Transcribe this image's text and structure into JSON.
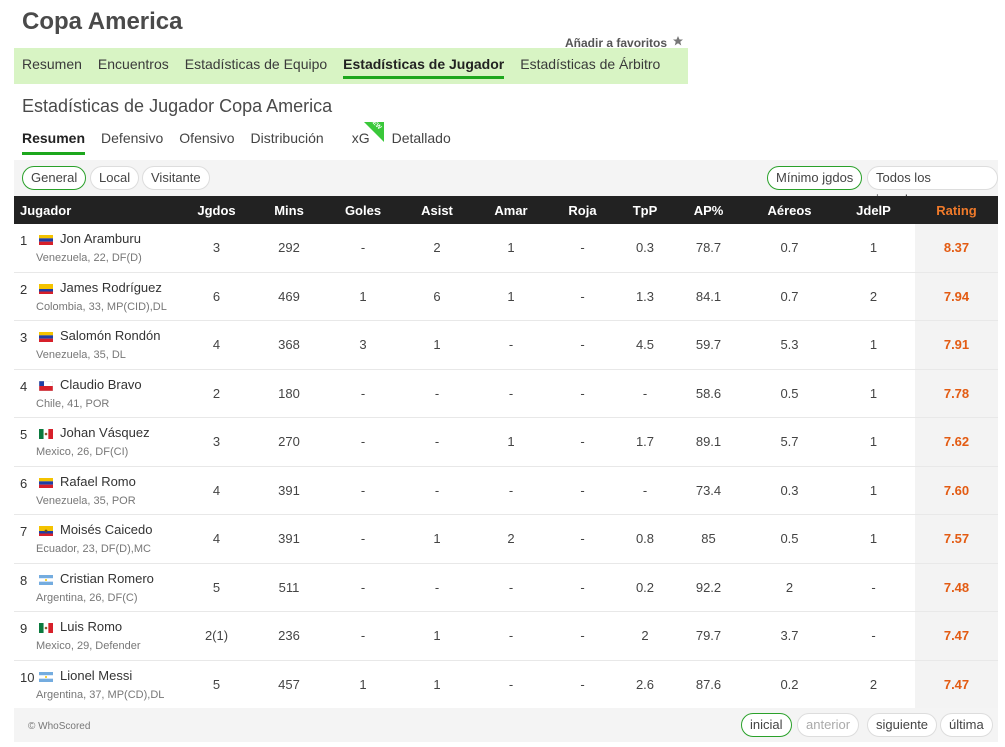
{
  "page": {
    "title": "Copa America",
    "favorite_label": "Añadir a favoritos"
  },
  "topnav": [
    "Resumen",
    "Encuentros",
    "Estadísticas de Equipo",
    "Estadísticas de Jugador",
    "Estadísticas de Árbitro"
  ],
  "subtitle": "Estadísticas de Jugador Copa America",
  "subnav": [
    "Resumen",
    "Defensivo",
    "Ofensivo",
    "Distribución",
    "xG",
    "Detallado"
  ],
  "new_badge": "NEW",
  "filters": {
    "left": [
      "General",
      "Local",
      "Visitante"
    ],
    "right": [
      "Mínimo jgdos",
      "Todos los jugadores"
    ]
  },
  "columns": [
    "Jugador",
    "Jgdos",
    "Mins",
    "Goles",
    "Asist",
    "Amar",
    "Roja",
    "TpP",
    "AP%",
    "Aéreos",
    "JdelP",
    "Rating"
  ],
  "colors": {
    "accent": "#1da71d",
    "rating": "#e35b12",
    "header_bg": "#222222",
    "nav_bg": "#d8f4c4"
  },
  "players": [
    {
      "rank": "1",
      "name": "Jon Aramburu",
      "meta": "Venezuela,  22, DF(D)",
      "flag": "venezuela",
      "jgdos": "3",
      "mins": "292",
      "goles": "-",
      "asist": "2",
      "amar": "1",
      "roja": "-",
      "tpp": "0.3",
      "ap": "78.7",
      "aereos": "0.7",
      "jdelp": "1",
      "rating": "8.37"
    },
    {
      "rank": "2",
      "name": "James Rodríguez",
      "meta": "Colombia,  33, MP(CID),DL",
      "flag": "colombia",
      "jgdos": "6",
      "mins": "469",
      "goles": "1",
      "asist": "6",
      "amar": "1",
      "roja": "-",
      "tpp": "1.3",
      "ap": "84.1",
      "aereos": "0.7",
      "jdelp": "2",
      "rating": "7.94"
    },
    {
      "rank": "3",
      "name": "Salomón Rondón",
      "meta": "Venezuela,  35, DL",
      "flag": "venezuela",
      "jgdos": "4",
      "mins": "368",
      "goles": "3",
      "asist": "1",
      "amar": "-",
      "roja": "-",
      "tpp": "4.5",
      "ap": "59.7",
      "aereos": "5.3",
      "jdelp": "1",
      "rating": "7.91"
    },
    {
      "rank": "4",
      "name": "Claudio Bravo",
      "meta": "Chile,  41, POR",
      "flag": "chile",
      "jgdos": "2",
      "mins": "180",
      "goles": "-",
      "asist": "-",
      "amar": "-",
      "roja": "-",
      "tpp": "-",
      "ap": "58.6",
      "aereos": "0.5",
      "jdelp": "1",
      "rating": "7.78"
    },
    {
      "rank": "5",
      "name": "Johan Vásquez",
      "meta": "Mexico,  26, DF(CI)",
      "flag": "mexico",
      "jgdos": "3",
      "mins": "270",
      "goles": "-",
      "asist": "-",
      "amar": "1",
      "roja": "-",
      "tpp": "1.7",
      "ap": "89.1",
      "aereos": "5.7",
      "jdelp": "1",
      "rating": "7.62"
    },
    {
      "rank": "6",
      "name": "Rafael Romo",
      "meta": "Venezuela,  35, POR",
      "flag": "venezuela",
      "jgdos": "4",
      "mins": "391",
      "goles": "-",
      "asist": "-",
      "amar": "-",
      "roja": "-",
      "tpp": "-",
      "ap": "73.4",
      "aereos": "0.3",
      "jdelp": "1",
      "rating": "7.60"
    },
    {
      "rank": "7",
      "name": "Moisés Caicedo",
      "meta": "Ecuador,  23, DF(D),MC",
      "flag": "ecuador",
      "jgdos": "4",
      "mins": "391",
      "goles": "-",
      "asist": "1",
      "amar": "2",
      "roja": "-",
      "tpp": "0.8",
      "ap": "85",
      "aereos": "0.5",
      "jdelp": "1",
      "rating": "7.57"
    },
    {
      "rank": "8",
      "name": "Cristian Romero",
      "meta": "Argentina,  26, DF(C)",
      "flag": "argentina",
      "jgdos": "5",
      "mins": "511",
      "goles": "-",
      "asist": "-",
      "amar": "-",
      "roja": "-",
      "tpp": "0.2",
      "ap": "92.2",
      "aereos": "2",
      "jdelp": "-",
      "rating": "7.48"
    },
    {
      "rank": "9",
      "name": "Luis Romo",
      "meta": "Mexico,  29, Defender",
      "flag": "mexico",
      "jgdos": "2(1)",
      "mins": "236",
      "goles": "-",
      "asist": "1",
      "amar": "-",
      "roja": "-",
      "tpp": "2",
      "ap": "79.7",
      "aereos": "3.7",
      "jdelp": "-",
      "rating": "7.47"
    },
    {
      "rank": "10",
      "name": "Lionel Messi",
      "meta": "Argentina,  37, MP(CD),DL",
      "flag": "argentina",
      "jgdos": "5",
      "mins": "457",
      "goles": "1",
      "asist": "1",
      "amar": "-",
      "roja": "-",
      "tpp": "2.6",
      "ap": "87.6",
      "aereos": "0.2",
      "jdelp": "2",
      "rating": "7.47"
    }
  ],
  "footer": {
    "copyright": "© WhoScored",
    "pagination": [
      "inicial",
      "anterior",
      "siguiente",
      "última"
    ]
  }
}
